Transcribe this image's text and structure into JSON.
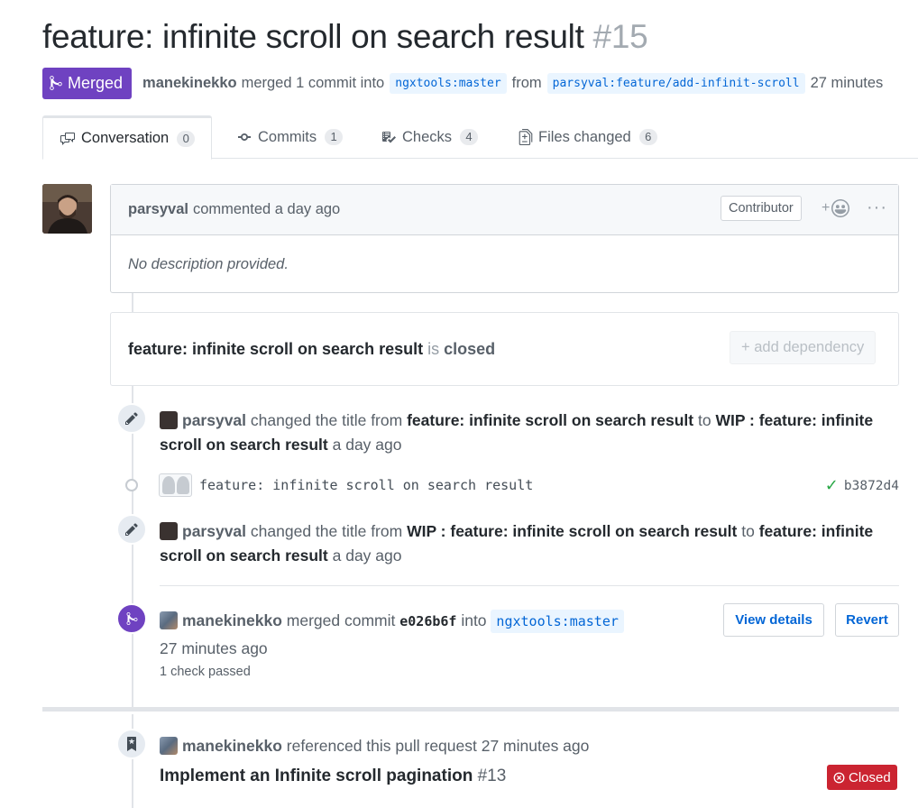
{
  "pr": {
    "title": "feature: infinite scroll on search result",
    "number": "#15",
    "state": "Merged",
    "author": "manekinekko",
    "merged_text": "merged 1 commit into",
    "base_ref": "ngxtools:master",
    "from_text": "from",
    "head_ref": "parsyval:feature/add-infinit-scroll",
    "time": "27 minutes"
  },
  "tabs": [
    {
      "label": "Conversation",
      "count": "0",
      "icon": "comment-discussion-icon"
    },
    {
      "label": "Commits",
      "count": "1",
      "icon": "git-commit-icon"
    },
    {
      "label": "Checks",
      "count": "4",
      "icon": "checklist-icon"
    },
    {
      "label": "Files changed",
      "count": "6",
      "icon": "file-diff-icon"
    }
  ],
  "comment": {
    "author": "parsyval",
    "action": "commented a day ago",
    "role": "Contributor",
    "body": "No description provided."
  },
  "dependency": {
    "title": "feature: infinite scroll on search result",
    "is_text": "is",
    "status": "closed",
    "button": "+ add dependency"
  },
  "events": {
    "rename1": {
      "user": "parsyval",
      "action": "changed the title from",
      "from": "feature: infinite scroll on search result",
      "to_word": "to",
      "to": "WIP : feature: infinite scroll on search result",
      "time": "a day ago"
    },
    "commit": {
      "message": "feature: infinite scroll on search result",
      "sha": "b3872d4"
    },
    "rename2": {
      "user": "parsyval",
      "action": "changed the title from",
      "from": "WIP : feature: infinite scroll on search result",
      "to_word": "to",
      "to": "feature: infinite scroll on search result",
      "time": "a day ago"
    },
    "merge": {
      "user": "manekinekko",
      "action": "merged commit",
      "sha": "e026b6f",
      "into": "into",
      "ref": "ngxtools:master",
      "time": "27 minutes ago",
      "checks": "1 check passed",
      "view_details": "View details",
      "revert": "Revert"
    },
    "reference": {
      "user": "manekinekko",
      "action": "referenced this pull request 27 minutes ago",
      "issue_title": "Implement an Infinite scroll pagination",
      "issue_number": "#13",
      "issue_state": "Closed"
    }
  },
  "colors": {
    "merged": "#6f42c1",
    "closed": "#cb2431",
    "link": "#0366d6",
    "success": "#28a745"
  }
}
